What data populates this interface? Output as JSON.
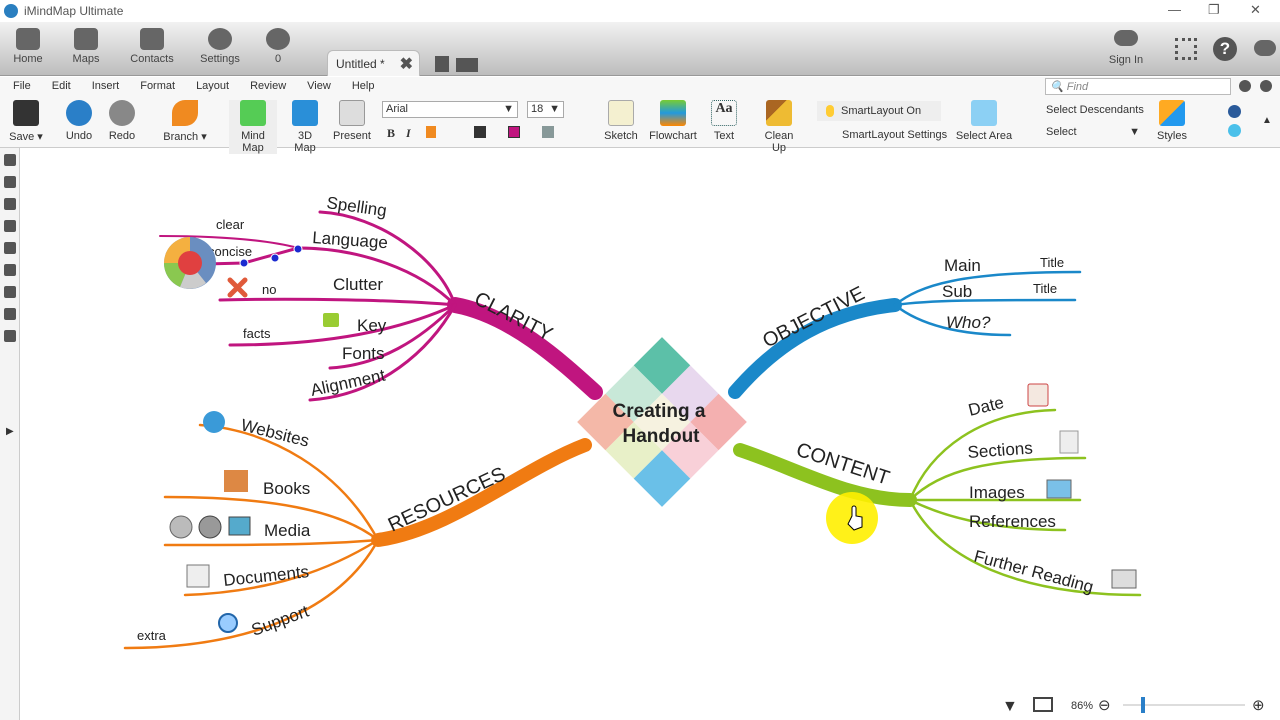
{
  "window": {
    "title": "iMindMap Ultimate",
    "minimize": "—",
    "restore": "❐",
    "close": "✕"
  },
  "nav": [
    {
      "label": "Home",
      "icon": "home-icon"
    },
    {
      "label": "Maps",
      "icon": "maps-icon"
    },
    {
      "label": "Contacts",
      "icon": "contacts-icon"
    },
    {
      "label": "Settings",
      "icon": "gear-icon"
    },
    {
      "label": "0",
      "icon": "notification-icon"
    }
  ],
  "tab": {
    "label": "Untitled *",
    "close": "✖"
  },
  "topright": {
    "signin": "Sign In"
  },
  "menu": [
    "File",
    "Edit",
    "Insert",
    "Format",
    "Layout",
    "Review",
    "View",
    "Help"
  ],
  "find": {
    "placeholder": "Find"
  },
  "ribbon": {
    "save": "Save ▾",
    "undo": "Undo",
    "redo": "Redo",
    "branch": "Branch ▾",
    "mindmap": "Mind Map",
    "map3d": "3D Map",
    "present": "Present",
    "font": "Arial",
    "size": "18",
    "sketch": "Sketch",
    "flowchart": "Flowchart",
    "text": "Text",
    "cleanup": "Clean Up",
    "smartlayout_on": "SmartLayout On",
    "smartlayout_settings": "SmartLayout Settings",
    "select_area": "Select Area",
    "select_descendants": "Select Descendants",
    "select": "Select",
    "styles": "Styles",
    "bold": "B",
    "italic": "I"
  },
  "colors": {
    "clarity": "#c0157f",
    "objective": "#1a88c9",
    "content": "#8dc21f",
    "resources": "#f07b12"
  },
  "map": {
    "central": [
      "Creating a",
      "Handout"
    ],
    "clarity": {
      "label": "CLARITY",
      "children": [
        "Spelling",
        "Language",
        "Clutter",
        "Key",
        "Fonts",
        "Alignment"
      ],
      "sub": [
        "clear",
        "concise",
        "no",
        "facts"
      ]
    },
    "objective": {
      "label": "OBJECTIVE",
      "children": [
        "Main",
        "Sub",
        "Who?"
      ],
      "sub": [
        "Title",
        "Title"
      ]
    },
    "content": {
      "label": "CONTENT",
      "children": [
        "Date",
        "Sections",
        "Images",
        "References",
        "Further Reading"
      ]
    },
    "resources": {
      "label": "RESOURCES",
      "children": [
        "Websites",
        "Books",
        "Media",
        "Documents",
        "Support"
      ],
      "sub": [
        "extra"
      ]
    }
  },
  "status": {
    "zoom": "86%",
    "zoom_level": 0.15
  }
}
